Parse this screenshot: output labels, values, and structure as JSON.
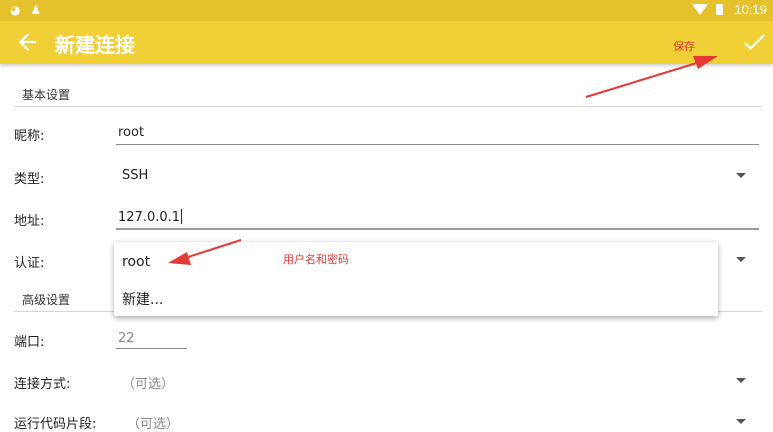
{
  "status_bar": {
    "time": "10:19",
    "left_icons": [
      "app-notification-icon",
      "qq-notification-icon"
    ],
    "right_icons": [
      "wifi-icon",
      "battery-icon"
    ]
  },
  "toolbar": {
    "title": "新建连接",
    "back_icon": "arrow-left-icon",
    "save_icon": "check-icon",
    "save_annotation": "保存",
    "bg_color": "#f0cf37"
  },
  "sections": {
    "basic": "基本设置",
    "advanced": "高级设置"
  },
  "form": {
    "nickname": {
      "label": "昵称:",
      "value": "root"
    },
    "type": {
      "label": "类型:",
      "value": "SSH"
    },
    "address": {
      "label": "地址:",
      "value": "127.0.0.1"
    },
    "auth": {
      "label": "认证:"
    },
    "port": {
      "label": "端口:",
      "placeholder": "22"
    },
    "connect_method": {
      "label": "连接方式:",
      "placeholder": "（可选）"
    },
    "run_snippet": {
      "label": "运行代码片段:",
      "placeholder": "（可选）"
    }
  },
  "auth_popup": {
    "options": [
      "root",
      "新建..."
    ],
    "annotation": "用户名和密码"
  },
  "annotation_color": "#e53935"
}
